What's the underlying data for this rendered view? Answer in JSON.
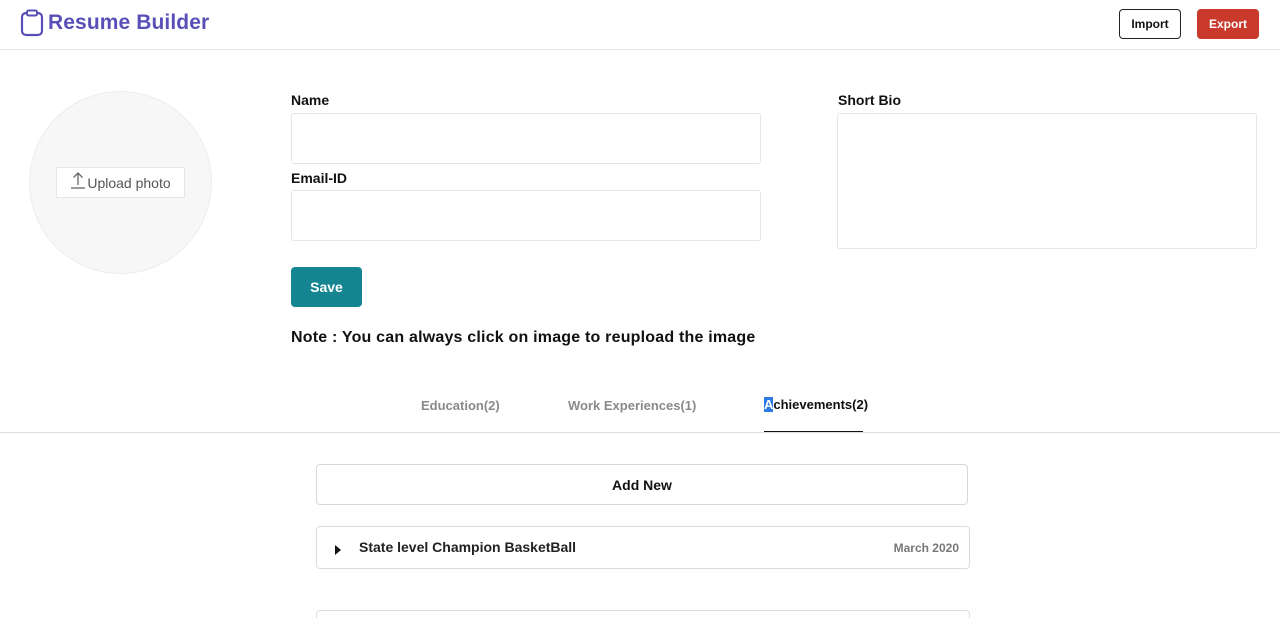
{
  "header": {
    "brand_icon": "clipboard-icon",
    "brand_title": "Resume Builder",
    "brand_color": "#5a4fb6",
    "import_label": "Import",
    "export_label": "Export",
    "export_color": "#c9392c"
  },
  "photo": {
    "upload_icon": "upload-icon",
    "upload_label": "Upload photo"
  },
  "form": {
    "name_label": "Name",
    "name_value": "",
    "email_label": "Email-ID",
    "email_value": "",
    "bio_label": "Short Bio",
    "bio_value": "",
    "save_label": "Save",
    "save_color": "#168592",
    "note": "Note : You can always click on image to reupload the image"
  },
  "tabs": [
    {
      "label": "Education(2)",
      "active": false
    },
    {
      "label": "Work Experiences(1)",
      "active": false
    },
    {
      "label_highlight": "A",
      "label_rest": "chievements(2)",
      "active": true
    }
  ],
  "achievements": {
    "add_label": "Add New",
    "items": [
      {
        "title": "State level Champion BasketBall",
        "date": "March 2020",
        "icon": "caret-right-icon"
      }
    ]
  }
}
